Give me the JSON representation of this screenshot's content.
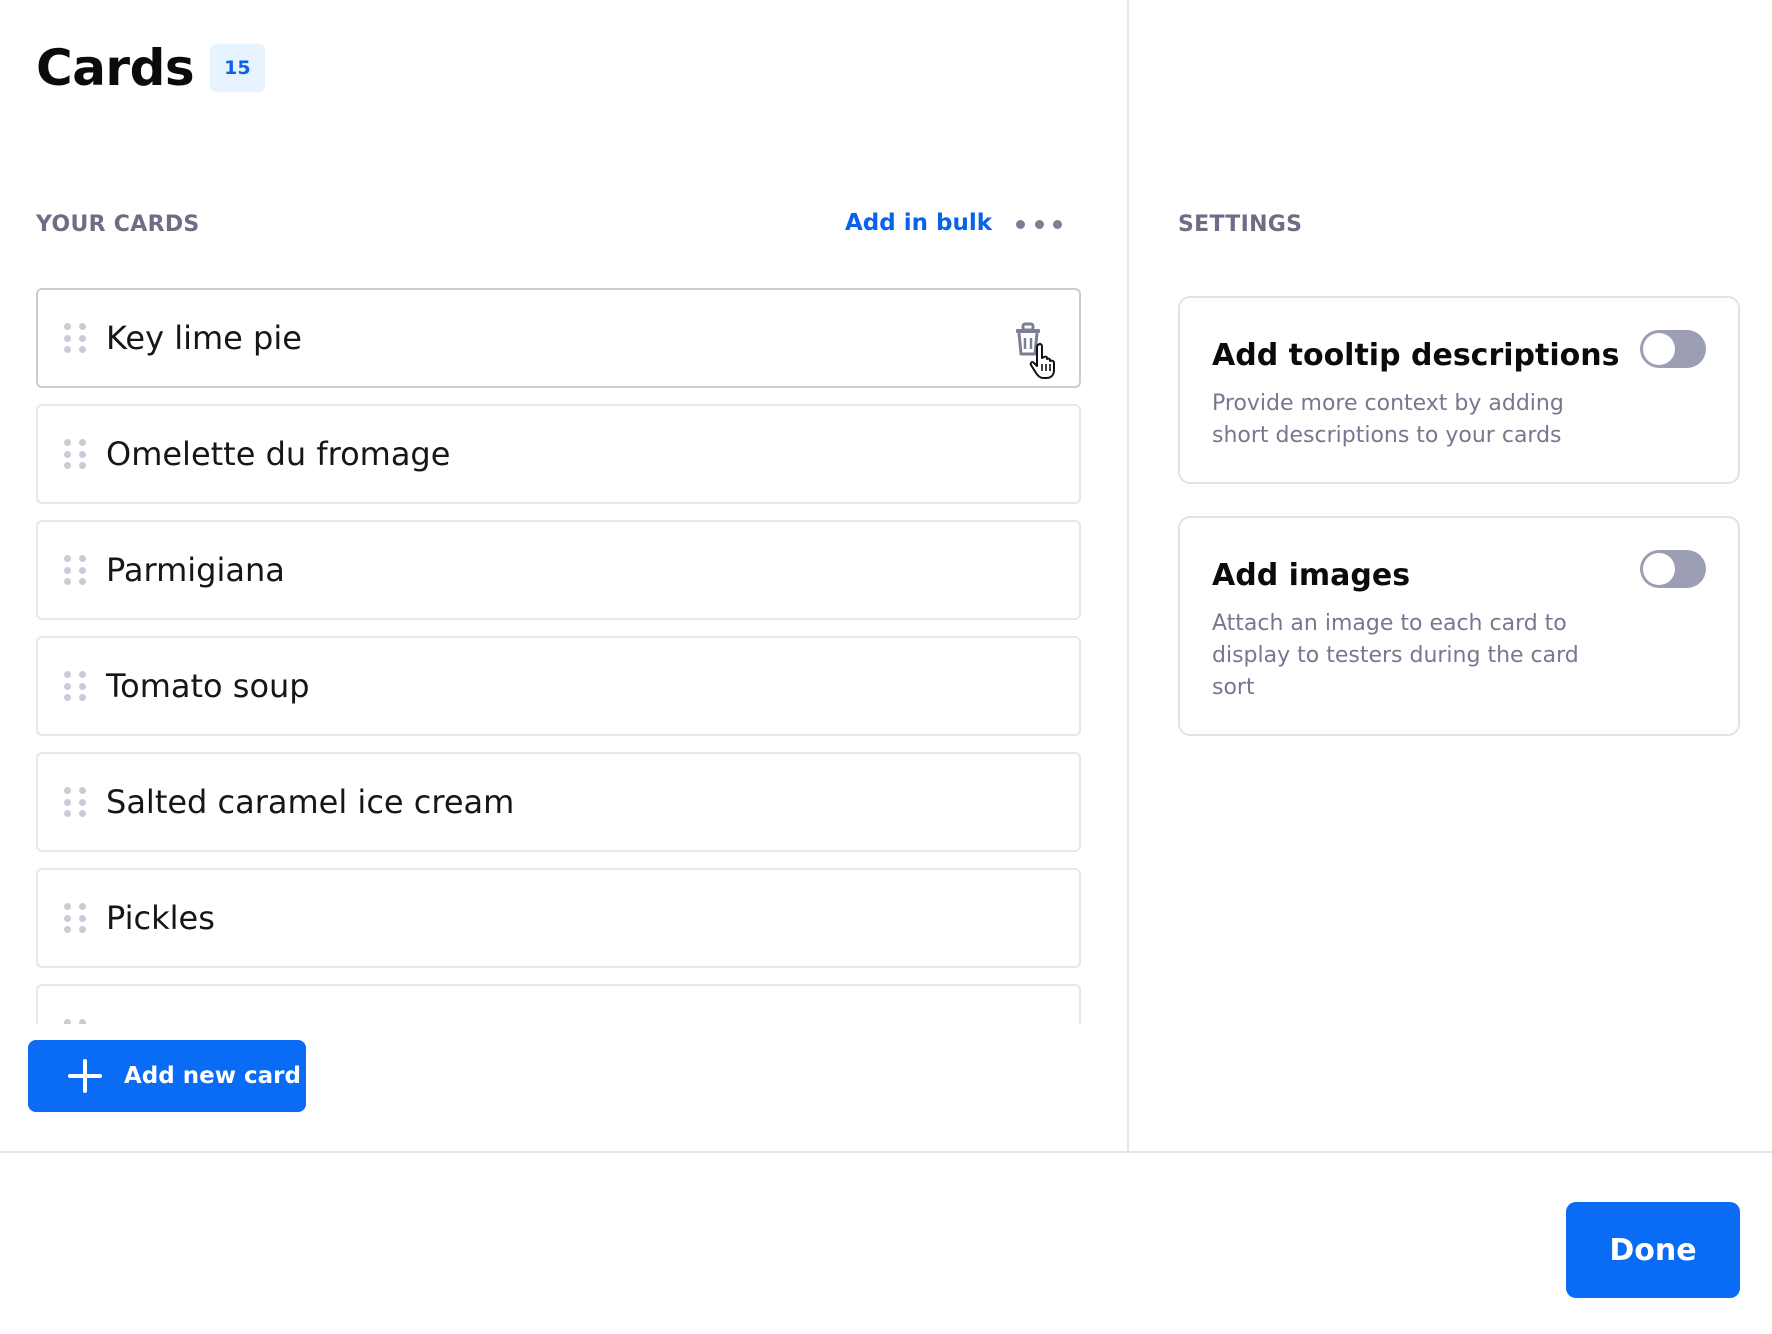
{
  "header": {
    "title": "Cards",
    "count": "15"
  },
  "cards_section": {
    "label": "YOUR CARDS",
    "add_bulk_label": "Add in bulk",
    "more_icon": "more-horizontal-icon",
    "items": [
      {
        "label": "Key lime pie"
      },
      {
        "label": "Omelette du fromage"
      },
      {
        "label": "Parmigiana"
      },
      {
        "label": "Tomato soup"
      },
      {
        "label": "Salted caramel ice cream"
      },
      {
        "label": "Pickles"
      },
      {
        "label": ""
      }
    ],
    "add_card_label": "Add new card"
  },
  "settings": {
    "label": "SETTINGS",
    "options": [
      {
        "title": "Add tooltip descriptions",
        "description": "Provide more context by adding short descriptions to your cards",
        "enabled": false
      },
      {
        "title": "Add images",
        "description": "Attach an image to each card to display to testers during the card sort",
        "enabled": false
      }
    ]
  },
  "footer": {
    "done_label": "Done"
  },
  "colors": {
    "accent": "#0a6cf5",
    "link": "#0a62e8",
    "badge_bg": "#e7f3fe",
    "toggle_off": "#9c9eb4"
  }
}
